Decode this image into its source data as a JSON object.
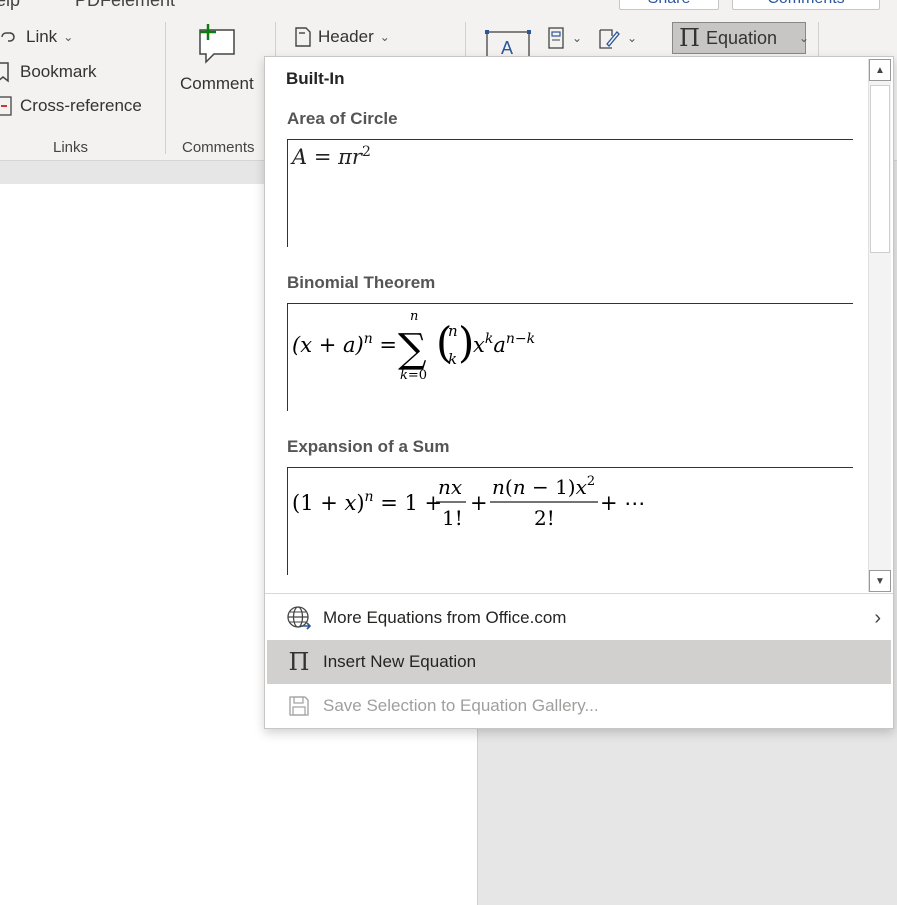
{
  "ribbon": {
    "menubar": {
      "help": "elp",
      "pdfelement": "PDFelement"
    },
    "share_label": "Share",
    "comments_label": "Comments",
    "links": {
      "link": "Link",
      "bookmark": "Bookmark",
      "cross_reference": "Cross-reference",
      "group_label": "Links"
    },
    "comments_group": {
      "comment": "Comment",
      "group_label": "Comments"
    },
    "header_label": "Header",
    "equation_label": "Equation"
  },
  "dropdown": {
    "section_header": "Built-In",
    "items": [
      {
        "title": "Area of Circle"
      },
      {
        "title": "Binomial Theorem"
      },
      {
        "title": "Expansion of a Sum"
      }
    ],
    "menu": [
      {
        "label": "More Equations from Office.com",
        "icon": "globe-icon",
        "has_submenu": true
      },
      {
        "label": "Insert New Equation",
        "icon": "pi-icon",
        "highlighted": true
      },
      {
        "label": "Save Selection to Equation Gallery...",
        "icon": "save-icon",
        "disabled": true
      }
    ]
  },
  "colors": {
    "accent": "#2b579a",
    "highlight": "#d2d0ce",
    "disabled": "#a19f9d"
  }
}
